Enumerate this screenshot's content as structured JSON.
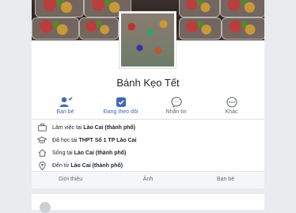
{
  "page": {
    "name": "Bánh Kẹo Tết"
  },
  "actions": [
    {
      "label": "Bạn bè",
      "icon": "friends-icon"
    },
    {
      "label": "Đang theo dõi",
      "icon": "following-check-icon"
    },
    {
      "label": "Nhắn tin",
      "icon": "messenger-icon"
    },
    {
      "label": "Khác",
      "icon": "more-icon"
    }
  ],
  "info": {
    "work": {
      "prefix": "Làm việc tại ",
      "place": "Lào Cai (thành phố)"
    },
    "study": {
      "prefix": "Đã học tại ",
      "place": "THPT Số 1 TP Lào Cai"
    },
    "lives": {
      "prefix": "Sống tại ",
      "place": "Lào Cai (thành phố)"
    },
    "from": {
      "prefix": "Đến từ ",
      "place": "Lào Cai (thành phố)"
    }
  },
  "tabs": [
    "Giới thiệu",
    "Ảnh",
    "Bạn bè"
  ],
  "colors": {
    "accent": "#4267b2",
    "text": "#1d2129",
    "muted": "#606770",
    "background": "#e9ebee"
  }
}
